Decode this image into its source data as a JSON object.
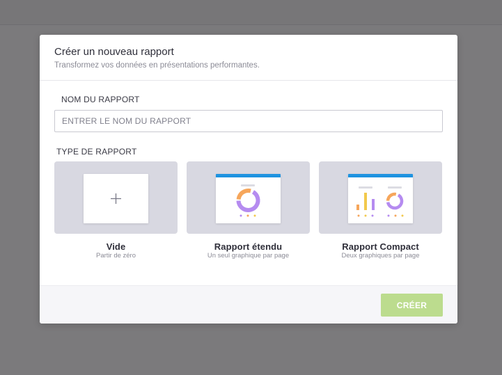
{
  "modal": {
    "title": "Créer un nouveau rapport",
    "subtitle": "Transformez vos données en présentations performantes."
  },
  "form": {
    "name_label": "NOM DU RAPPORT",
    "name_placeholder": "ENTRER LE NOM DU RAPPORT",
    "name_value": "",
    "type_label": "TYPE DE RAPPORT"
  },
  "report_types": [
    {
      "name": "Vide",
      "description": "Partir de zéro",
      "icon": "plus-icon"
    },
    {
      "name": "Rapport étendu",
      "description": "Un seul graphique par page",
      "icon": "donut-chart-icon"
    },
    {
      "name": "Rapport Compact",
      "description": "Deux graphiques par page",
      "icon": "bar-and-donut-chart-icon"
    }
  ],
  "footer": {
    "create_label": "CRÉER"
  },
  "colors": {
    "accent_blue": "#1e93e0",
    "button_green_disabled": "#bcdc8e",
    "card_bg": "#d8d8e1",
    "donut_purple": "#b58bf0",
    "donut_orange": "#f6a65b",
    "bar_yellow": "#f2c94c"
  }
}
